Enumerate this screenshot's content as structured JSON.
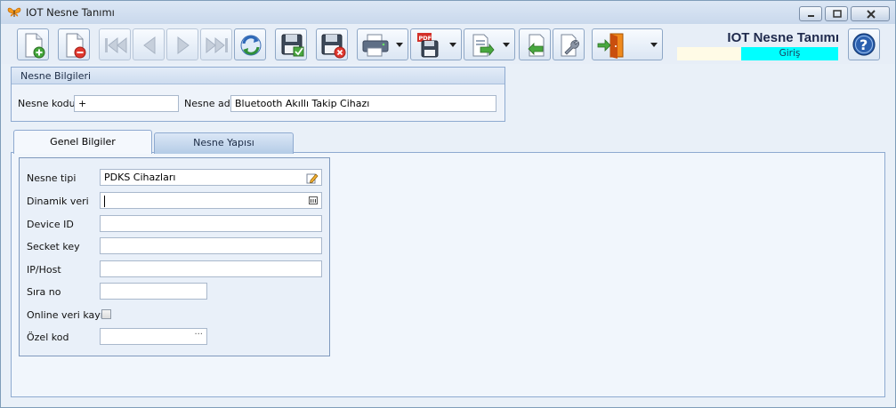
{
  "window": {
    "title": "IOT Nesne Tanımı"
  },
  "toolbar": {
    "buttons": [
      {
        "id": "new",
        "icon": "new-document-icon",
        "enabled": true
      },
      {
        "id": "delete",
        "icon": "delete-document-icon",
        "enabled": true
      },
      {
        "id": "first",
        "icon": "first-record-icon",
        "enabled": false
      },
      {
        "id": "prev",
        "icon": "previous-record-icon",
        "enabled": false
      },
      {
        "id": "next",
        "icon": "next-record-icon",
        "enabled": false
      },
      {
        "id": "last",
        "icon": "last-record-icon",
        "enabled": false
      },
      {
        "id": "refresh",
        "icon": "refresh-icon",
        "enabled": true
      },
      {
        "id": "save",
        "icon": "save-icon",
        "enabled": true
      },
      {
        "id": "cancel",
        "icon": "save-cancel-icon",
        "enabled": true
      },
      {
        "id": "print",
        "icon": "printer-icon",
        "enabled": true
      },
      {
        "id": "pdf",
        "icon": "pdf-save-icon",
        "enabled": true
      },
      {
        "id": "export",
        "icon": "export-icon",
        "enabled": true
      },
      {
        "id": "import",
        "icon": "import-icon",
        "enabled": true
      },
      {
        "id": "tools",
        "icon": "wrench-icon",
        "enabled": true
      },
      {
        "id": "exit",
        "icon": "exit-door-icon",
        "enabled": true
      }
    ],
    "form_title": "IOT Nesne Tanımı",
    "mode": "Giriş",
    "help_icon": "help-icon"
  },
  "nesne_bilgileri": {
    "header": "Nesne Bilgileri",
    "kod_label": "Nesne kodu",
    "kod_value": "+",
    "ad_label": "Nesne adı",
    "ad_value": "Bluetooth Akıllı Takip Cihazı"
  },
  "tabs": {
    "genel": "Genel Bilgiler",
    "yapi": "Nesne Yapısı"
  },
  "genel": {
    "nesne_tipi_label": "Nesne tipi",
    "nesne_tipi_value": "PDKS Cihazları",
    "dinamik_veri_label": "Dinamik veri",
    "dinamik_veri_value": "",
    "device_id_label": "Device ID",
    "device_id_value": "",
    "secket_key_label": "Secket key",
    "secket_key_value": "",
    "ip_host_label": "IP/Host",
    "ip_host_value": "",
    "sira_no_label": "Sıra no",
    "sira_no_value": "",
    "online_label": "Online veri kayıt",
    "online_checked": false,
    "ozel_kod_label": "Özel kod",
    "ozel_kod_value": "",
    "ellipsis": "···"
  },
  "colors": {
    "mode_badge": "#00ffff",
    "title_text": "#1f2a4d",
    "panel_border": "#8eaad0"
  }
}
